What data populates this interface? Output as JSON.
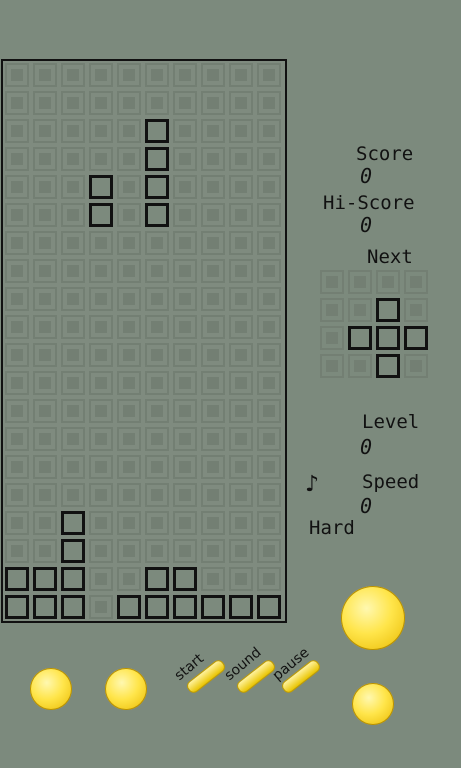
{
  "hud": {
    "score_label": "Score",
    "score_value": "0",
    "hiscore_label": "Hi-Score",
    "hiscore_value": "0",
    "next_label": "Next",
    "level_label": "Level",
    "level_value": "0",
    "speed_label": "Speed",
    "speed_value": "0",
    "difficulty": "Hard",
    "sound_symbol": "♪"
  },
  "board": {
    "cols": 10,
    "rows": 20,
    "filled": [
      [
        6,
        3
      ],
      [
        7,
        3
      ],
      [
        4,
        5
      ],
      [
        5,
        5
      ],
      [
        6,
        5
      ],
      [
        7,
        5
      ],
      [
        18,
        2
      ],
      [
        19,
        2
      ],
      [
        20,
        0
      ],
      [
        20,
        1
      ],
      [
        20,
        2
      ],
      [
        20,
        5
      ],
      [
        20,
        6
      ],
      [
        21,
        0
      ],
      [
        21,
        1
      ],
      [
        21,
        2
      ],
      [
        21,
        4
      ],
      [
        21,
        5
      ],
      [
        21,
        6
      ],
      [
        21,
        7
      ],
      [
        21,
        8
      ],
      [
        21,
        9
      ]
    ]
  },
  "next_piece": {
    "cells": [
      [
        1,
        2
      ],
      [
        2,
        1
      ],
      [
        2,
        2
      ],
      [
        2,
        3
      ],
      [
        3,
        2
      ]
    ]
  },
  "controls": {
    "start_label": "start",
    "sound_label": "sound",
    "pause_label": "pause"
  }
}
